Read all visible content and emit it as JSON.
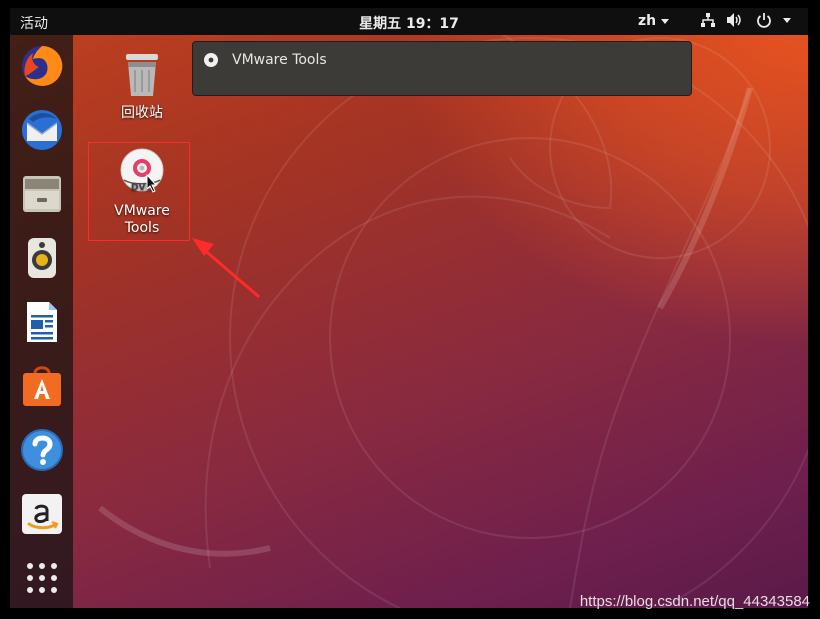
{
  "topbar": {
    "activities_label": "活动",
    "clock": "星期五 19：17",
    "lang": "zh",
    "tray_icons": [
      "network-icon",
      "volume-icon",
      "power-icon"
    ]
  },
  "dock": {
    "items": [
      {
        "name": "firefox-icon"
      },
      {
        "name": "thunderbird-icon"
      },
      {
        "name": "files-icon"
      },
      {
        "name": "rhythmbox-icon"
      },
      {
        "name": "writer-icon"
      },
      {
        "name": "software-icon"
      },
      {
        "name": "help-icon"
      },
      {
        "name": "amazon-icon"
      },
      {
        "name": "show-apps-icon"
      }
    ]
  },
  "desktop": {
    "trash_label": "回收站",
    "vmware_label_line1": "VMware",
    "vmware_label_line2": "Tools"
  },
  "notification": {
    "text": "VMware Tools"
  },
  "watermark": "https://blog.csdn.net/qq_44343584",
  "colors": {
    "accent": "#e95420",
    "highlight": "#ff2a2a",
    "topbar": "#0f0f0f",
    "notification_bg": "#3c3b37"
  }
}
